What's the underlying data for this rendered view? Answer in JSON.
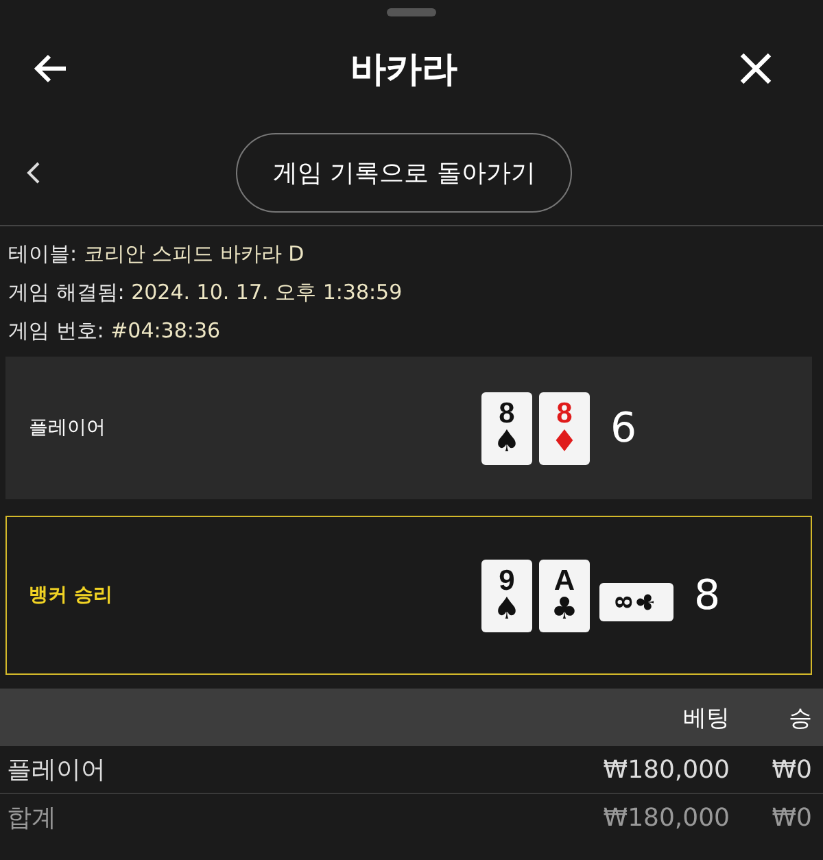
{
  "header": {
    "title": "바카라"
  },
  "back_link": {
    "label": "게임 기록으로 돌아가기"
  },
  "info": [
    {
      "label": "테이블:",
      "value": "코리안 스피드 바카라 D"
    },
    {
      "label": "게임 해결됨:",
      "value": "2024. 10. 17. 오후 1:38:59"
    },
    {
      "label": "게임 번호:",
      "value": "#04:38:36"
    }
  ],
  "hands": [
    {
      "label": "플레이어",
      "winner": false,
      "score": "6",
      "cards": [
        {
          "rank": "8",
          "suit": "♠",
          "color": "#111111",
          "sideways": false
        },
        {
          "rank": "8",
          "suit": "♦",
          "color": "#e01b1b",
          "sideways": false
        }
      ]
    },
    {
      "label": "뱅커 승리",
      "winner": true,
      "score": "8",
      "cards": [
        {
          "rank": "9",
          "suit": "♠",
          "color": "#111111",
          "sideways": false
        },
        {
          "rank": "A",
          "suit": "♣",
          "color": "#111111",
          "sideways": false
        },
        {
          "rank": "8",
          "suit": "♣",
          "color": "#111111",
          "sideways": true
        }
      ]
    }
  ],
  "bets": {
    "columns": [
      "베팅",
      "승"
    ],
    "rows": [
      {
        "kind": "line",
        "label": "플레이어",
        "bet": "₩180,000",
        "win": "₩0"
      },
      {
        "kind": "total",
        "label": "합계",
        "bet": "₩180,000",
        "win": "₩0"
      }
    ]
  }
}
